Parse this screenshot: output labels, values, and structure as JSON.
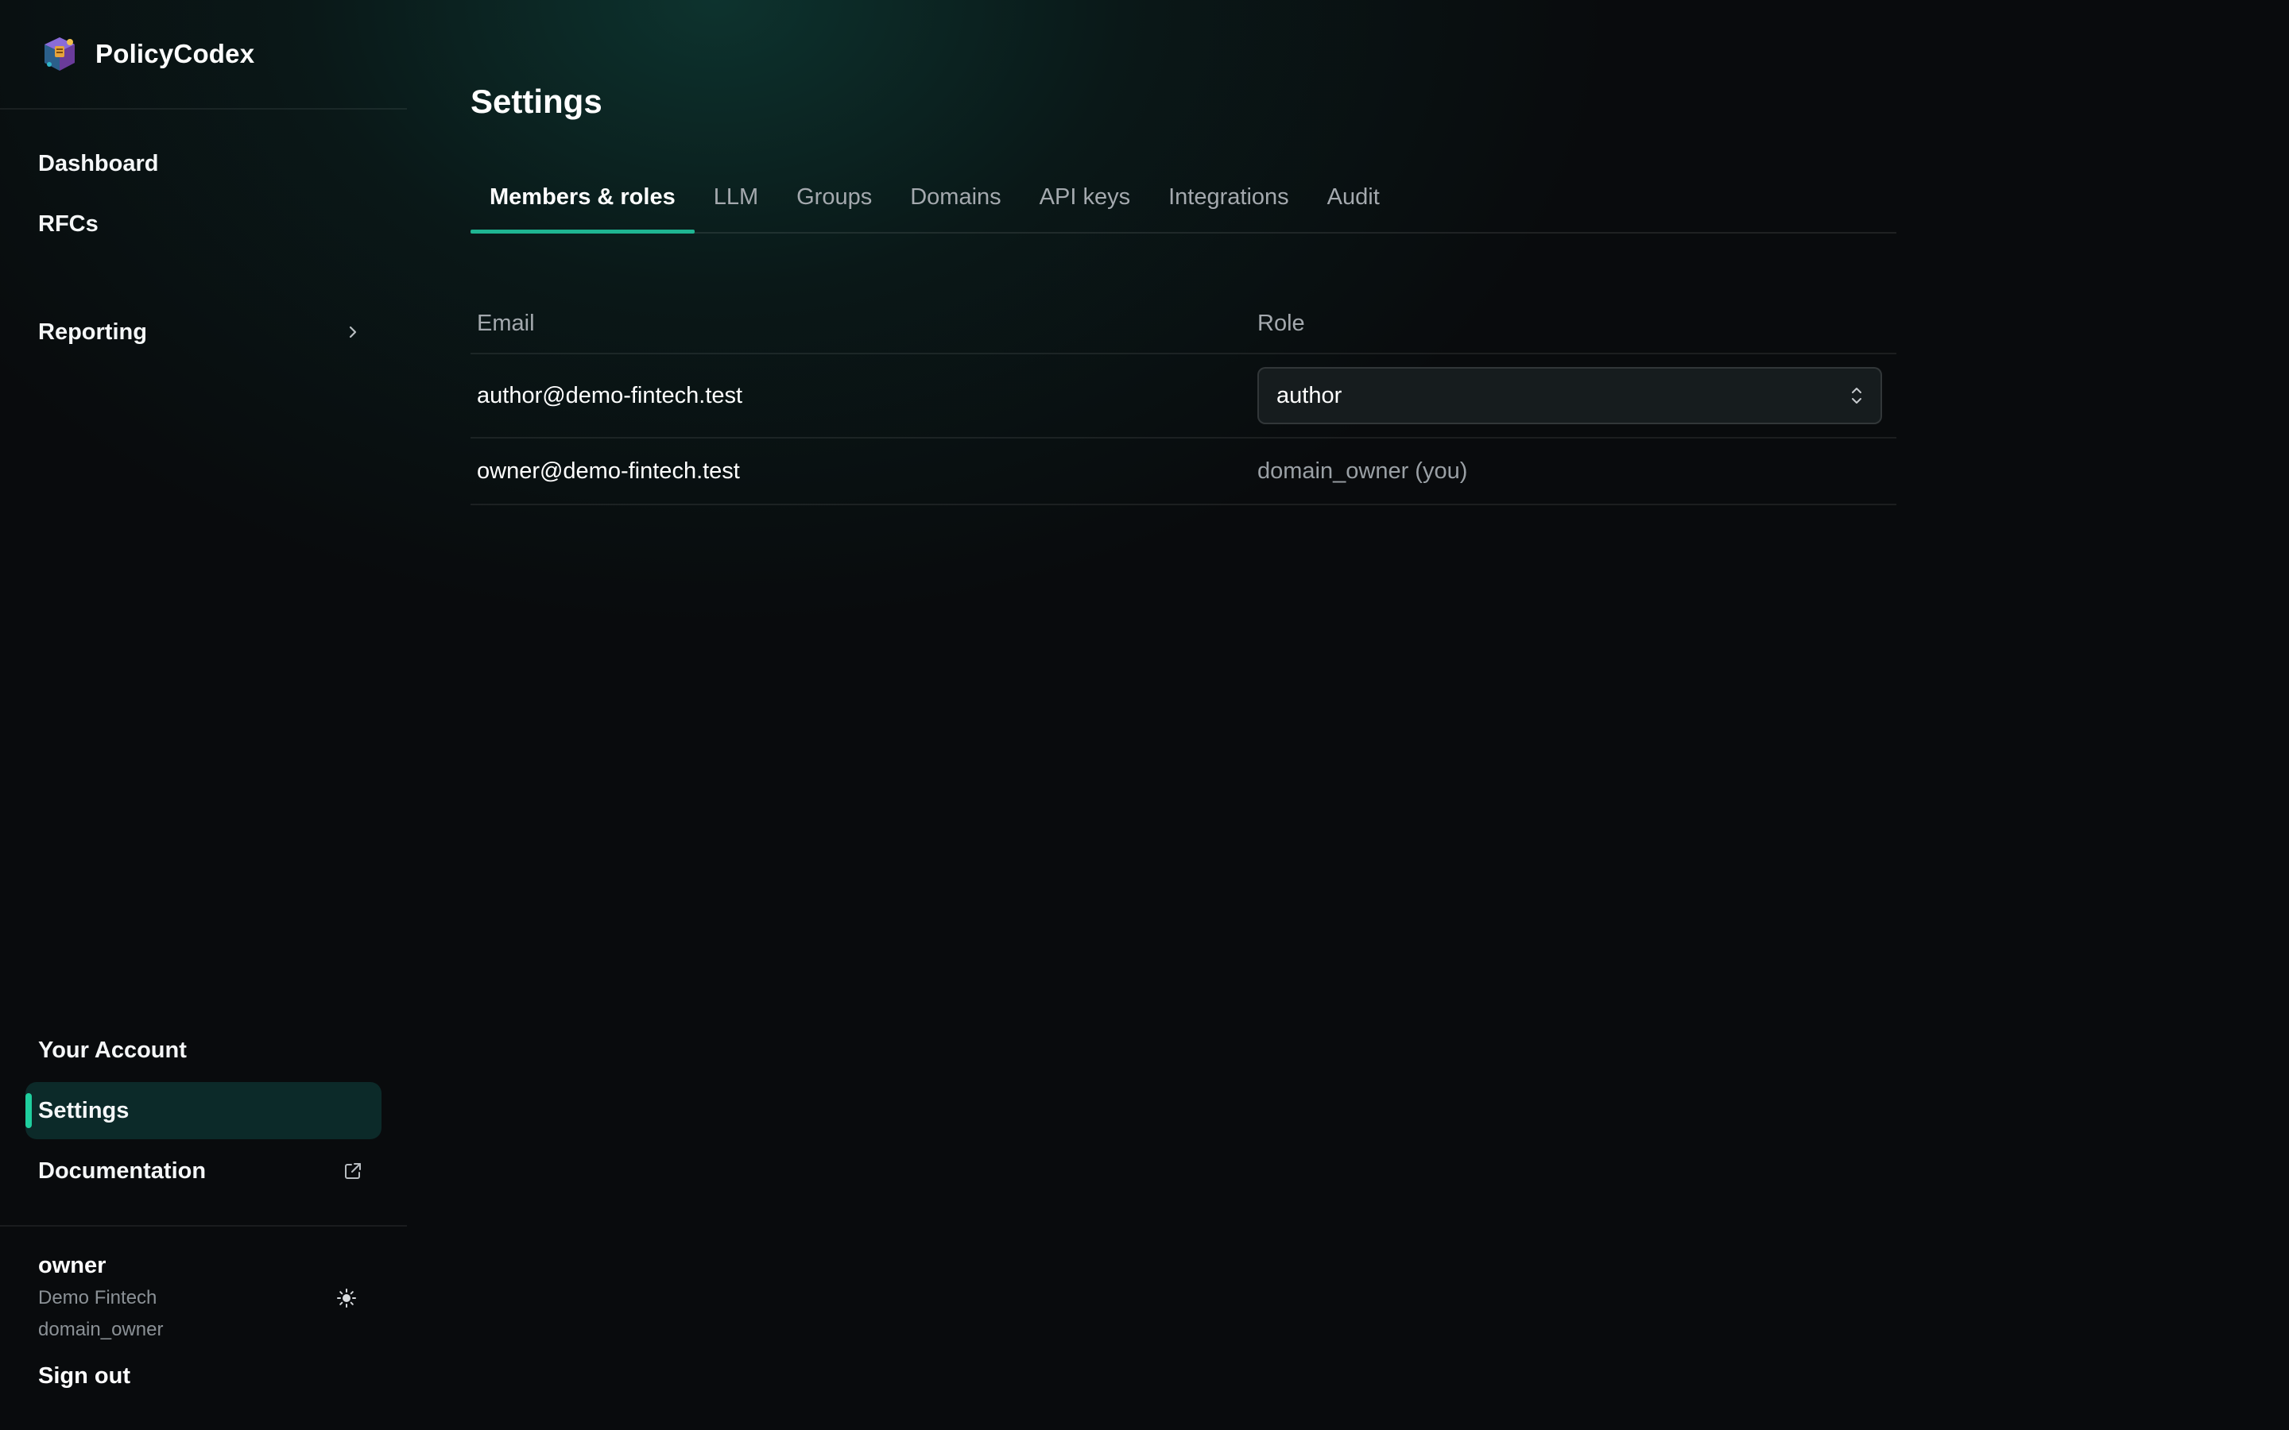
{
  "app": {
    "name": "PolicyCodex"
  },
  "sidebar": {
    "nav_top": [
      {
        "label": "Dashboard"
      },
      {
        "label": "RFCs"
      }
    ],
    "reporting": {
      "label": "Reporting",
      "icon": "chevron-right-icon"
    },
    "nav_bottom": [
      {
        "label": "Your Account"
      },
      {
        "label": "Settings",
        "active": true
      },
      {
        "label": "Documentation",
        "icon": "external-link-icon"
      }
    ],
    "user": {
      "name": "owner",
      "org": "Demo Fintech",
      "role": "domain_owner",
      "theme_icon": "sun-icon"
    },
    "sign_out": "Sign out"
  },
  "main": {
    "title": "Settings",
    "tabs": [
      {
        "label": "Members & roles",
        "active": true
      },
      {
        "label": "LLM"
      },
      {
        "label": "Groups"
      },
      {
        "label": "Domains"
      },
      {
        "label": "API keys"
      },
      {
        "label": "Integrations"
      },
      {
        "label": "Audit"
      }
    ],
    "members_table": {
      "headers": {
        "email": "Email",
        "role": "Role"
      },
      "rows": [
        {
          "email": "author@demo-fintech.test",
          "role_select": "author"
        },
        {
          "email": "owner@demo-fintech.test",
          "role_text": "domain_owner (you)"
        }
      ]
    }
  },
  "colors": {
    "accent": "#1fcf9e",
    "active_nav_bg": "#0c2a29",
    "background": "#090b0d"
  }
}
